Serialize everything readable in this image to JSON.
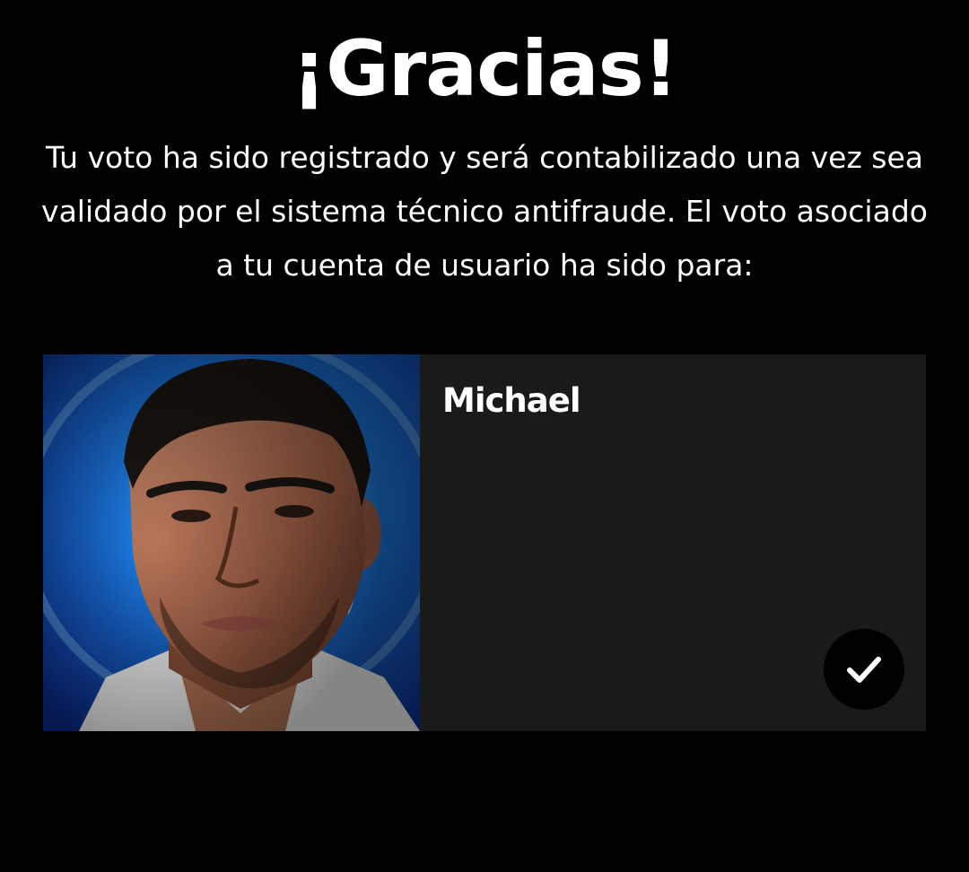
{
  "header": {
    "title": "¡Gracias!",
    "message": "Tu voto ha sido registrado y será contabilizado una vez sea validado por el sistema técnico antifraude. El voto asociado a tu cuenta de usuario ha sido para:"
  },
  "vote_card": {
    "photo_icon": "contestant-portrait",
    "candidate_name": "Michael",
    "selected_icon": "checkmark-icon",
    "selected": true
  },
  "colors": {
    "background": "#000000",
    "card_background": "#1a1a1a",
    "text": "#ffffff",
    "photo_backdrop": "#1c7ae0"
  }
}
